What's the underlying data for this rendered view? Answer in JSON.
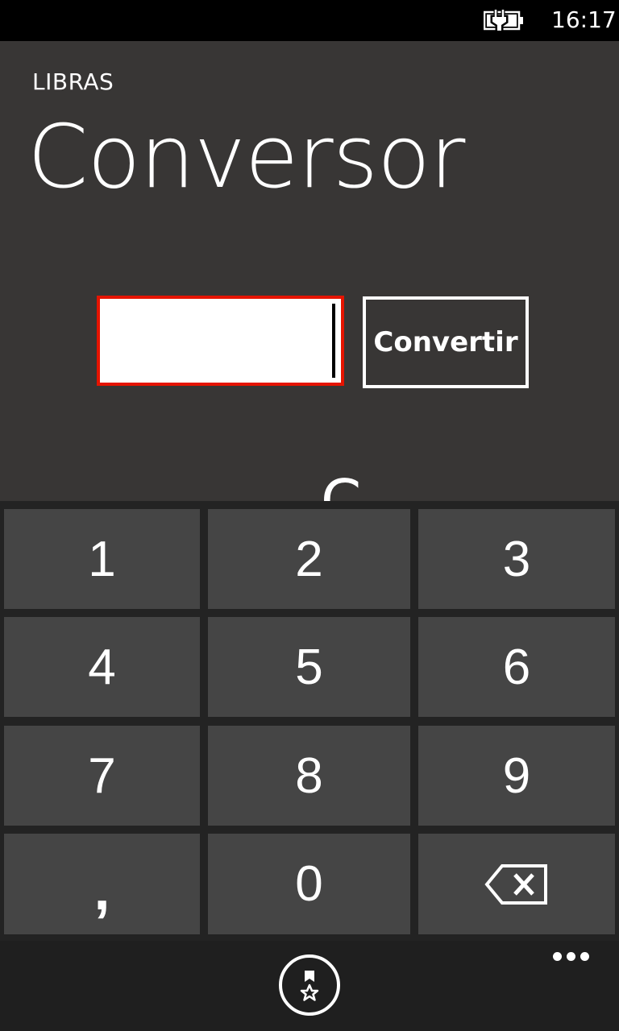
{
  "status_bar": {
    "time": "16:17",
    "battery_icon": "battery-charging-icon"
  },
  "header": {
    "app_title": "LIBRAS",
    "page_title": "Conversor"
  },
  "converter": {
    "input_value": "",
    "button_label": "Convertir",
    "result_partial": "C"
  },
  "keypad": {
    "keys": [
      "1",
      "2",
      "3",
      "4",
      "5",
      "6",
      "7",
      "8",
      "9",
      ",",
      "0"
    ],
    "backspace_icon": "backspace-icon"
  },
  "app_bar": {
    "favorite_icon": "favorite-icon",
    "more_icon": "more-icon"
  },
  "colors": {
    "background": "#383635",
    "accent": "#e51400",
    "key": "#454545",
    "keypad_background": "#232323",
    "app_bar": "#1f1f1f"
  }
}
